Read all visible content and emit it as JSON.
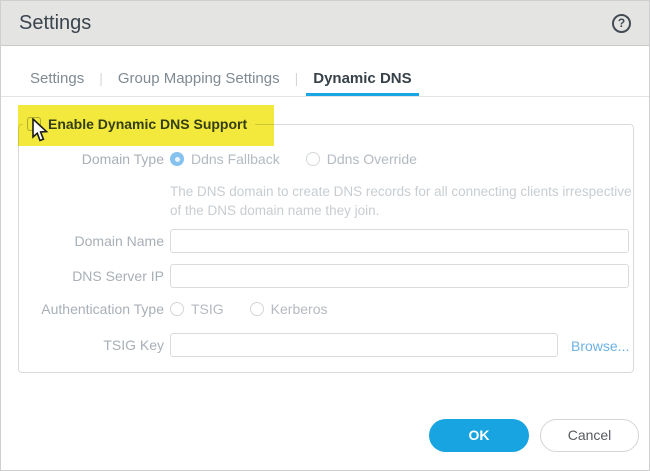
{
  "window": {
    "title": "Settings",
    "help_icon": "?"
  },
  "tabs": {
    "separator": "|",
    "items": [
      {
        "label": "Settings",
        "active": false
      },
      {
        "label": "Group Mapping Settings",
        "active": false
      },
      {
        "label": "Dynamic DNS",
        "active": true
      }
    ]
  },
  "form": {
    "enable": {
      "label": "Enable Dynamic DNS Support",
      "checked": false,
      "highlighted": true
    },
    "domain_type": {
      "label": "Domain Type",
      "options": [
        {
          "label": "Ddns Fallback",
          "selected": true
        },
        {
          "label": "Ddns Override",
          "selected": false
        }
      ],
      "description_line1": "The DNS domain to create DNS records for all connecting clients irrespective",
      "description_line2": "of the DNS domain name they join."
    },
    "domain_name": {
      "label": "Domain Name",
      "value": "",
      "placeholder": ""
    },
    "dns_server_ip": {
      "label": "DNS Server IP",
      "value": "",
      "placeholder": ""
    },
    "authentication_type": {
      "label": "Authentication Type",
      "options": [
        {
          "label": "TSIG",
          "selected": false
        },
        {
          "label": "Kerberos",
          "selected": false
        }
      ]
    },
    "tsig_key": {
      "label": "TSIG Key",
      "value": "",
      "placeholder": "",
      "browse_label": "Browse..."
    }
  },
  "footer": {
    "ok_label": "OK",
    "cancel_label": "Cancel"
  },
  "colors": {
    "accent_blue": "#1aa6e5",
    "ok_button": "#17a4e0",
    "highlight_yellow": "#f2e93c",
    "header_bg": "#e4e4e3"
  }
}
